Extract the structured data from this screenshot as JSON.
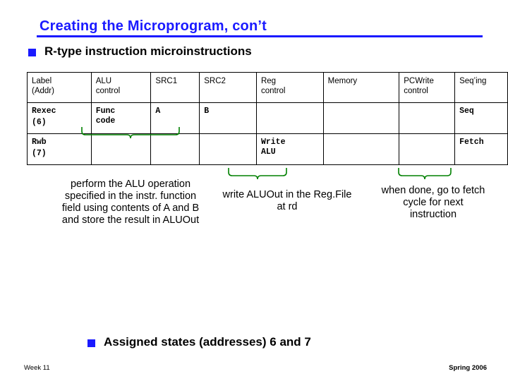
{
  "slide": {
    "title": "Creating the Microprogram, con’t",
    "bullets": [
      {
        "marker": "q",
        "text": "R-type instruction microinstructions"
      },
      {
        "marker": "q",
        "text": "Assigned states (addresses) 6 and 7"
      }
    ],
    "table": {
      "headers": [
        {
          "line1": "Label",
          "line2": "(Addr)"
        },
        {
          "line1": "ALU",
          "line2": "control"
        },
        {
          "line1": "SRC1",
          "line2": ""
        },
        {
          "line1": "SRC2",
          "line2": ""
        },
        {
          "line1": "Reg",
          "line2": "control"
        },
        {
          "line1": "Memory",
          "line2": ""
        },
        {
          "line1": "PCWrite",
          "line2": "control"
        },
        {
          "line1": "Seq’ing",
          "line2": ""
        }
      ],
      "rows": [
        {
          "label_line1": "Rexec",
          "label_line2": "(6)",
          "alu_line1": "Func",
          "alu_line2": "code",
          "src1": "A",
          "src2": "B",
          "reg_line1": "",
          "reg_line2": "",
          "memory": "",
          "pcwrite": "",
          "seqing": "Seq"
        },
        {
          "label_line1": "Rwb",
          "label_line2": "(7)",
          "alu_line1": "",
          "alu_line2": "",
          "src1": "",
          "src2": "",
          "reg_line1": "Write",
          "reg_line2": "ALU",
          "memory": "",
          "pcwrite": "",
          "seqing": "Fetch"
        }
      ]
    },
    "captions": [
      "perform the ALU operation specified in the instr. function field using contents of A and B and store the result in ALUOut",
      "write ALUOut in the Reg.File at rd",
      "when done, go to fetch cycle for next instruction"
    ],
    "footer": {
      "left": "Week 11",
      "right": "Spring 2006"
    },
    "colors": {
      "title": "#1a1aff",
      "bullet": "#1a1aff",
      "brace": "#008000",
      "text": "#000000"
    }
  }
}
